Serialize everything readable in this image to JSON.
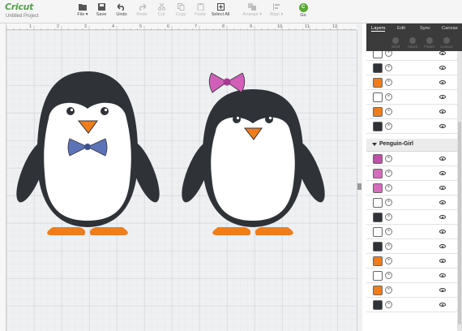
{
  "app": {
    "brand": "Cricut",
    "project_name": "Untitled Project"
  },
  "toolbar": {
    "file_label": "File ▾",
    "save_label": "Save",
    "undo_label": "Undo",
    "redo_label": "Redo",
    "cut_label": "Cut",
    "copy_label": "Copy",
    "paste_label": "Paste",
    "select_all_label": "Select All",
    "arrange_label": "Arrange ▾",
    "align_label": "Align ▾",
    "go_label": "Go"
  },
  "ruler": {
    "h_ticks": [
      "1",
      "2",
      "3",
      "4",
      "5",
      "6",
      "7",
      "8",
      "9",
      "10",
      "11",
      "12"
    ]
  },
  "panel": {
    "tabs": [
      "Layers",
      "Edit",
      "Sync",
      "Canvas"
    ],
    "active_tab": "Layers",
    "tools": [
      "Weld",
      "Attach",
      "Flatten",
      "Contour"
    ]
  },
  "layers": {
    "top_rows": [
      {
        "color": "#ffffff",
        "icon": "eyebrow-layer"
      },
      {
        "color": "#2f3237",
        "icon": "body-layer"
      },
      {
        "color": "#f07d1c",
        "icon": "beak-layer"
      },
      {
        "color": "#ffffff",
        "icon": "belly-layer"
      },
      {
        "color": "#f07d1c",
        "icon": "feet-layer"
      },
      {
        "color": "#2f3237",
        "icon": "eyes-layer"
      }
    ],
    "group_name": "Penguin-Girl",
    "group_rows": [
      {
        "color": "#c24fa6",
        "icon": "bow-center-layer"
      },
      {
        "color": "#d66bbd",
        "icon": "bow-left-layer"
      },
      {
        "color": "#d66bbd",
        "icon": "bow-right-layer"
      },
      {
        "color": "#ffffff",
        "icon": "eyelash-layer"
      },
      {
        "color": "#2f3237",
        "icon": "body-layer"
      },
      {
        "color": "#ffffff",
        "icon": "eyebrow-layer"
      },
      {
        "color": "#2f3237",
        "icon": "head-layer"
      },
      {
        "color": "#f07d1c",
        "icon": "beak-layer"
      },
      {
        "color": "#ffffff",
        "icon": "belly-layer"
      },
      {
        "color": "#f07d1c",
        "icon": "feet-layer"
      },
      {
        "color": "#2f3237",
        "icon": "eyes-layer"
      }
    ]
  },
  "colors": {
    "penguin_body": "#2f3237",
    "beak_feet": "#f07d1c",
    "boy_bow": "#5d73b8",
    "girl_bow": "#d15fb8",
    "accent_green": "#5ba935"
  }
}
